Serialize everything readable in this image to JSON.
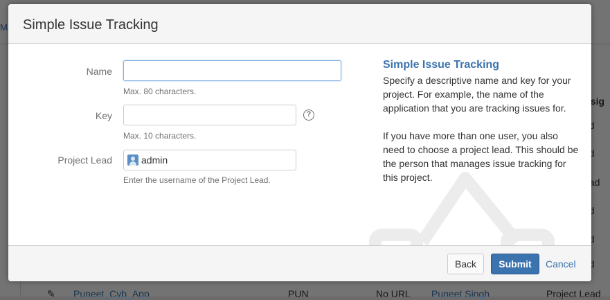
{
  "background": {
    "top_tab": "Ma",
    "column_header": "ssig",
    "cells": [
      "ed",
      "ed",
      "ead",
      "ed",
      "ed",
      "ed",
      "ed"
    ],
    "bottom_row": {
      "project": "Puneet_Cyb_App",
      "key": "PUN",
      "url": "No URL",
      "lead": "Puneet Singh",
      "assignee": "Project Lead"
    }
  },
  "dialog": {
    "title": "Simple Issue Tracking",
    "form": {
      "name_label": "Name",
      "name_value": "",
      "name_hint": "Max. 80 characters.",
      "key_label": "Key",
      "key_value": "",
      "key_hint": "Max. 10 characters.",
      "key_help_glyph": "?",
      "lead_label": "Project Lead",
      "lead_value": "admin",
      "lead_hint": "Enter the username of the Project Lead."
    },
    "info": {
      "title": "Simple Issue Tracking",
      "paragraph1": "Specify a descriptive name and key for your project. For example, the name of the application that you are tracking issues for.",
      "paragraph2": "If you have more than one user, you also need to choose a project lead. This should be the person that manages issue tracking for this project."
    },
    "footer": {
      "back_label": "Back",
      "submit_label": "Submit",
      "cancel_label": "Cancel"
    }
  },
  "colors": {
    "accent": "#3b73af",
    "submit_bg": "#3b73af",
    "focus_border": "#7faee0"
  },
  "icons": {
    "help": "question-circle-icon",
    "avatar": "user-avatar-icon"
  }
}
